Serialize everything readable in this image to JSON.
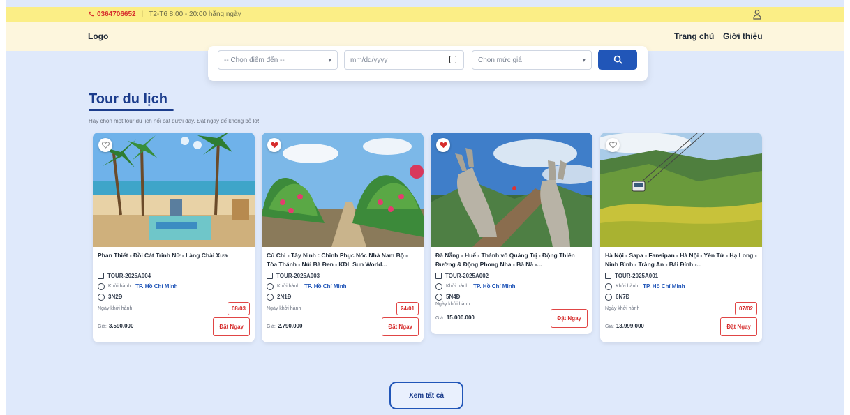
{
  "topbar": {
    "phone": "0364706652",
    "hours": "T2-T6 8:00 - 20:00 hằng ngày"
  },
  "nav": {
    "logo": "Logo",
    "links": [
      "Trang chủ",
      "Giới thiệu"
    ]
  },
  "search": {
    "destination_placeholder": "-- Chọn điểm đến --",
    "date_placeholder": "mm/dd/yyyy",
    "price_placeholder": "Chọn mức giá",
    "button_icon": "search-icon"
  },
  "section": {
    "title": "Tour du lịch",
    "subtitle": "Hãy chọn một tour du lịch nổi bật dưới đây. Đặt ngay để không bỏ lỡ!"
  },
  "labels": {
    "departure_prefix": "Khởi hành:",
    "date_label": "Ngày khởi hành",
    "price_prefix": "Giá:",
    "book": "Đặt Ngay"
  },
  "tours": [
    {
      "name": "Phan Thiết - Đồi Cát Trinh Nữ - Làng Chài Xưa",
      "code": "TOUR-2025A004",
      "departure": "TP. Hồ Chí Minh",
      "duration": "3N2Đ",
      "date": "08/03",
      "price": "3.590.000",
      "favorited": false
    },
    {
      "name": "Củ Chi - Tây Ninh : Chinh Phục Nóc Nhà Nam Bộ - Tòa Thánh - Núi Bà Đen - KDL Sun World...",
      "code": "TOUR-2025A003",
      "departure": "TP. Hồ Chí Minh",
      "duration": "2N1Đ",
      "date": "24/01",
      "price": "2.790.000",
      "favorited": true
    },
    {
      "name": "Đà Nẵng - Huế - Thánh vỏ Quảng Trị - Động Thiên Đường & Động Phong Nha - Bà Nà -...",
      "code": "TOUR-2025A002",
      "departure": "TP. Hồ Chí Minh",
      "duration": "5N4Đ",
      "date": "",
      "price": "15.000.000",
      "favorited": true
    },
    {
      "name": "Hà Nội - Sapa - Fansipan - Hà Nội - Yên Tử - Hạ Long - Ninh Bình - Tràng An - Bái Đính -...",
      "code": "TOUR-2025A001",
      "departure": "TP. Hồ Chí Minh",
      "duration": "6N7Đ",
      "date": "07/02",
      "price": "13.999.000",
      "favorited": false
    }
  ],
  "see_all": "Xem tất cả",
  "colors": {
    "topbar": "#fbee86",
    "accent": "#2156b8",
    "danger": "#d62d2d",
    "background": "#dfe9fb"
  }
}
